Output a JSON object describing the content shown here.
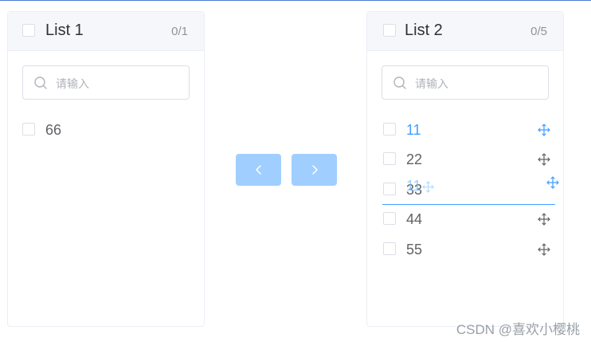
{
  "left_panel": {
    "title": "List 1",
    "count": "0/1",
    "search_placeholder": "请输入",
    "items": [
      {
        "label": "66"
      }
    ]
  },
  "right_panel": {
    "title": "List 2",
    "count": "0/5",
    "search_placeholder": "请输入",
    "items": [
      {
        "label": "11",
        "active": true
      },
      {
        "label": "22"
      },
      {
        "label": "33"
      },
      {
        "label": "44"
      },
      {
        "label": "55"
      }
    ]
  },
  "buttons": {
    "to_left_icon": "chevron-left-icon",
    "to_right_icon": "chevron-right-icon"
  },
  "drag": {
    "ghost_label": "11"
  },
  "colors": {
    "accent": "#409eff",
    "button_disabled": "#a0cfff"
  },
  "watermark": "CSDN @喜欢小樱桃"
}
